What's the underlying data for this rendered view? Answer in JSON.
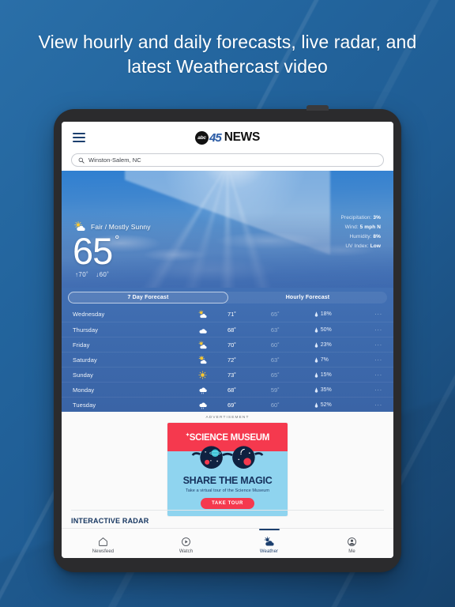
{
  "headline": "View hourly and daily forecasts, live radar, and latest Weathercast video",
  "appbar": {
    "menu_icon": "hamburger-menu-icon",
    "logo_abc": "abc",
    "logo_channel": "45",
    "logo_news": "NEWS"
  },
  "search": {
    "icon": "search-icon",
    "value": "Winston-Salem, NC",
    "placeholder": "Search location"
  },
  "current": {
    "condition_icon": "sun-behind-cloud-icon",
    "condition": "Fair / Mostly Sunny",
    "temperature": "65",
    "degree": "°",
    "high": "↑70˚",
    "low": "↓60˚",
    "stats": [
      {
        "label": "Precipitation:",
        "value": "3%"
      },
      {
        "label": "Wind:",
        "value": "5 mph N"
      },
      {
        "label": "Humidity:",
        "value": "8%"
      },
      {
        "label": "UV Index:",
        "value": "Low"
      }
    ]
  },
  "forecast": {
    "tabs": [
      {
        "label": "7 Day Forecast",
        "active": true
      },
      {
        "label": "Hourly Forecast",
        "active": false
      }
    ],
    "rows": [
      {
        "day": "Wednesday",
        "icon": "sun-behind-cloud-icon",
        "high": "71˚",
        "low": "65˚",
        "pop": "18%",
        "more": "···"
      },
      {
        "day": "Thursday",
        "icon": "cloud-icon",
        "high": "68˚",
        "low": "63˚",
        "pop": "50%",
        "more": "···"
      },
      {
        "day": "Friday",
        "icon": "sun-behind-cloud-icon",
        "high": "70˚",
        "low": "60˚",
        "pop": "23%",
        "more": "···"
      },
      {
        "day": "Saturday",
        "icon": "sun-behind-cloud-icon",
        "high": "72˚",
        "low": "63˚",
        "pop": "7%",
        "more": "···"
      },
      {
        "day": "Sunday",
        "icon": "sun-icon",
        "high": "73˚",
        "low": "65˚",
        "pop": "15%",
        "more": "···"
      },
      {
        "day": "Monday",
        "icon": "rain-cloud-icon",
        "high": "68˚",
        "low": "59˚",
        "pop": "35%",
        "more": "···"
      },
      {
        "day": "Tuesday",
        "icon": "rain-cloud-icon",
        "high": "69˚",
        "low": "60˚",
        "pop": "52%",
        "more": "···"
      }
    ]
  },
  "ad": {
    "label": "ADVERTISEMENT",
    "brand": "SCIENCE MUSEUM",
    "headline": "SHARE THE MAGIC",
    "subhead": "Take a virtual tour of the Science Museum",
    "cta": "TAKE TOUR"
  },
  "radar": {
    "title": "INTERACTIVE RADAR"
  },
  "bottom_nav": [
    {
      "label": "Newsfeed",
      "icon": "home-icon",
      "active": false
    },
    {
      "label": "Watch",
      "icon": "play-circle-icon",
      "active": false
    },
    {
      "label": "Weather",
      "icon": "sun-cloud-icon",
      "active": true
    },
    {
      "label": "Me",
      "icon": "person-icon",
      "active": false
    }
  ],
  "colors": {
    "background_blue": "#23659e",
    "brand_navy": "#1c3f6e",
    "forecast_blue": "#3d6aad",
    "ad_red": "#f5394e",
    "ad_sky": "#8fd4ef"
  }
}
